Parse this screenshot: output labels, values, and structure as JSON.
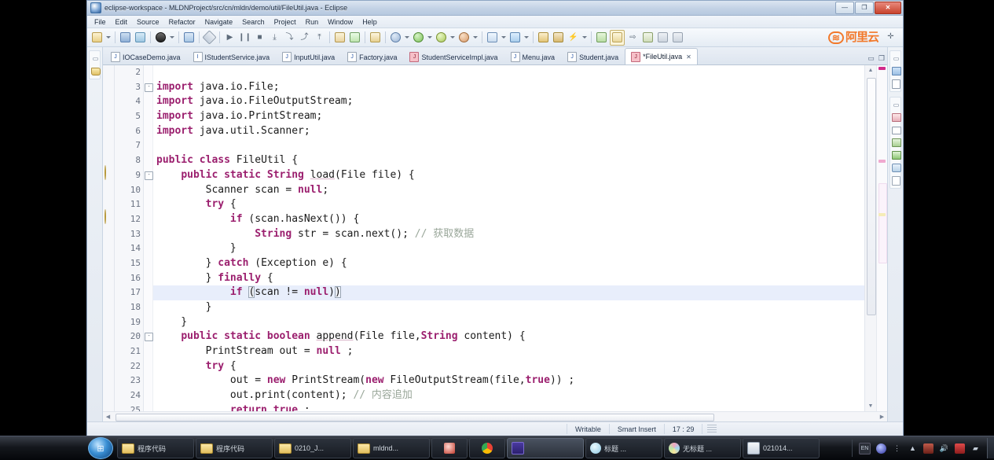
{
  "window": {
    "title": "eclipse-workspace - MLDNProject/src/cn/mldn/demo/util/FileUtil.java - Eclipse",
    "buttons": {
      "minimize": "—",
      "maximize": "❐",
      "close": "✕"
    }
  },
  "menubar": {
    "items": [
      "File",
      "Edit",
      "Source",
      "Refactor",
      "Navigate",
      "Search",
      "Project",
      "Run",
      "Window",
      "Help"
    ]
  },
  "toolbar": {
    "groups": [
      [
        "new-wizard-icon",
        "new-wizard-dropdown",
        "save-icon",
        "save-all-icon"
      ],
      [
        "print-icon",
        "print-dropdown"
      ],
      [
        "toggle-mark-occurrences-icon",
        "build-icon"
      ],
      [
        "run-icon",
        "pause-icon",
        "stop-icon",
        "step-into-icon",
        "step-over-icon",
        "step-return-icon",
        "drop-to-frame-icon"
      ],
      [
        "open-type-icon",
        "search-icon"
      ],
      [
        "new-java-project-icon",
        "java-perspective-icon"
      ],
      [
        "debug-icon",
        "debug-dropdown",
        "run-as-icon",
        "run-as-dropdown",
        "external-tools-icon",
        "external-tools-dropdown"
      ],
      [
        "new-java-class-icon",
        "new-java-class-dropdown",
        "new-annotation-icon",
        "new-annotation-dropdown"
      ],
      [
        "open-task-icon",
        "previous-edit-icon",
        "next-annotation-icon",
        "next-annotation-dropdown"
      ],
      [
        "back-icon",
        "forward-icon"
      ]
    ],
    "aliyun_logo": {
      "mark": "≋",
      "text": "阿里云"
    }
  },
  "tabs": [
    {
      "label": "IOCaseDemo.java",
      "icon": "java-file-icon",
      "active": false,
      "dirty": false
    },
    {
      "label": "IStudentService.java",
      "icon": "java-interface-icon",
      "active": false,
      "dirty": false
    },
    {
      "label": "InputUtil.java",
      "icon": "java-file-icon",
      "active": false,
      "dirty": false
    },
    {
      "label": "Factory.java",
      "icon": "java-file-icon",
      "active": false,
      "dirty": false
    },
    {
      "label": "StudentServiceImpl.java",
      "icon": "java-file-modified-icon",
      "active": false,
      "dirty": true
    },
    {
      "label": "Menu.java",
      "icon": "java-file-icon",
      "active": false,
      "dirty": false
    },
    {
      "label": "Student.java",
      "icon": "java-file-icon",
      "active": false,
      "dirty": false
    },
    {
      "label": "*FileUtil.java",
      "icon": "java-file-modified-icon",
      "active": true,
      "dirty": true,
      "close": "✕"
    }
  ],
  "tab_actions": {
    "minimize": "▭",
    "maximize": "❐"
  },
  "editor": {
    "first_line": 2,
    "highlighted_line": 17,
    "lines": [
      {
        "n": 2,
        "fold": "",
        "marker": "",
        "text": ""
      },
      {
        "n": 3,
        "fold": "-",
        "marker": "",
        "text": "import java.io.File;"
      },
      {
        "n": 4,
        "fold": "",
        "marker": "",
        "text": "import java.io.FileOutputStream;"
      },
      {
        "n": 5,
        "fold": "",
        "marker": "",
        "text": "import java.io.PrintStream;"
      },
      {
        "n": 6,
        "fold": "",
        "marker": "",
        "text": "import java.util.Scanner;"
      },
      {
        "n": 7,
        "fold": "",
        "marker": "",
        "text": ""
      },
      {
        "n": 8,
        "fold": "",
        "marker": "",
        "text": "public class FileUtil {"
      },
      {
        "n": 9,
        "fold": "-",
        "marker": "warning",
        "text": "    public static String load(File file) {"
      },
      {
        "n": 10,
        "fold": "",
        "marker": "",
        "text": "        Scanner scan = null;"
      },
      {
        "n": 11,
        "fold": "",
        "marker": "",
        "text": "        try {"
      },
      {
        "n": 12,
        "fold": "",
        "marker": "warning",
        "text": "            if (scan.hasNext()) {"
      },
      {
        "n": 13,
        "fold": "",
        "marker": "",
        "text": "                String str = scan.next(); // 获取数据"
      },
      {
        "n": 14,
        "fold": "",
        "marker": "",
        "text": "            }"
      },
      {
        "n": 15,
        "fold": "",
        "marker": "",
        "text": "        } catch (Exception e) {"
      },
      {
        "n": 16,
        "fold": "",
        "marker": "",
        "text": "        } finally {"
      },
      {
        "n": 17,
        "fold": "",
        "marker": "",
        "text": "            if (scan != null)"
      },
      {
        "n": 18,
        "fold": "",
        "marker": "",
        "text": "        }"
      },
      {
        "n": 19,
        "fold": "",
        "marker": "",
        "text": "    }"
      },
      {
        "n": 20,
        "fold": "-",
        "marker": "",
        "text": "    public static boolean append(File file,String content) {"
      },
      {
        "n": 21,
        "fold": "",
        "marker": "",
        "text": "        PrintStream out = null ;"
      },
      {
        "n": 22,
        "fold": "",
        "marker": "",
        "text": "        try {"
      },
      {
        "n": 23,
        "fold": "",
        "marker": "",
        "text": "            out = new PrintStream(new FileOutputStream(file,true)) ;"
      },
      {
        "n": 24,
        "fold": "",
        "marker": "",
        "text": "            out.print(content); // 内容追加"
      },
      {
        "n": 25,
        "fold": "",
        "marker": "",
        "text": "            return true ;"
      }
    ]
  },
  "statusbar": {
    "writable": "Writable",
    "insert_mode": "Smart Insert",
    "position": "17 : 29"
  },
  "left_strip": {
    "items": [
      "restore-view-icon",
      "package-explorer-icon"
    ]
  },
  "right_strip": {
    "items": [
      "restore-view-icon",
      "outline-icon",
      "task-list-icon",
      "quick-access-icon",
      "java-perspective-icon",
      "console-icon",
      "hierarchy-icon",
      "servers-icon",
      "problems-icon",
      "javadoc-icon"
    ]
  },
  "taskbar": {
    "start": "⊞",
    "items": [
      {
        "label": "程序代码",
        "icon": "folder-icon",
        "lit": false
      },
      {
        "label": "程序代码",
        "icon": "folder-icon",
        "lit": false
      },
      {
        "label": "0210_J...",
        "icon": "folder-icon",
        "lit": false
      },
      {
        "label": "mldnd...",
        "icon": "folder-icon",
        "lit": false
      },
      {
        "label": "",
        "icon": "eclipse-icon",
        "lit": false
      },
      {
        "label": "",
        "icon": "chrome-icon",
        "lit": false
      },
      {
        "label": "",
        "icon": "app-icon",
        "lit": true
      },
      {
        "label": "标题 ...",
        "icon": "media-icon",
        "lit": false
      },
      {
        "label": "无标题 ...",
        "icon": "paint-icon",
        "lit": false
      },
      {
        "label": "021014...",
        "icon": "doc-icon",
        "lit": false
      }
    ],
    "tray": [
      "ime-icon",
      "ie-icon",
      "more-icon",
      "show-hidden-icon",
      "network-icon",
      "volume-icon",
      "flag-icon",
      "signal-icon"
    ]
  }
}
